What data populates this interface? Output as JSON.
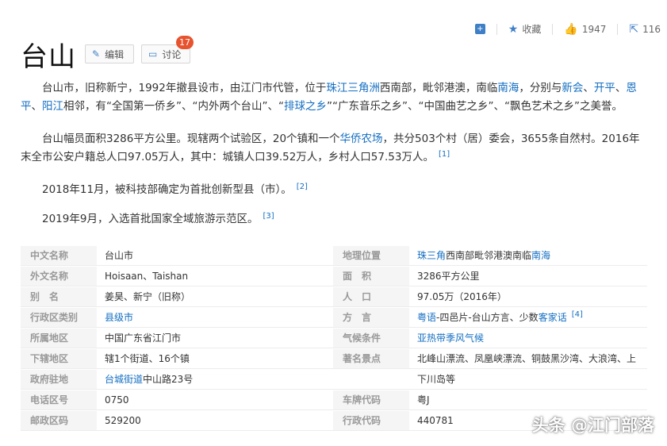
{
  "title": "台山",
  "buttons": {
    "edit": "编辑",
    "discuss": "讨论",
    "discuss_count": "17"
  },
  "toolbar": {
    "collect": "收藏",
    "likes": "1947",
    "shares": "116"
  },
  "para1": {
    "a": "台山市，旧称新宁，1992年撤县设市，由江门市代管，位于",
    "l1": "珠江三角洲",
    "b": "西南部，毗邻港澳，南临",
    "l2": "南海",
    "c": "，分别与",
    "l3": "新会",
    "d": "、",
    "l4": "开平",
    "e": "、",
    "l5": "恩平",
    "f": "、",
    "l6": "阳江",
    "g": "相邻，有“全国第一侨乡”、“内外两个台山”、“",
    "l7": "排球之乡",
    "h": "”“广东音乐之乡”、“中国曲艺之乡”、“飘色艺术之乡”之美誉。"
  },
  "para2": {
    "a": "台山幅员面积3286平方公里。现辖两个试验区，20个镇和一个",
    "l1": "华侨农场",
    "b": "，共分503个村（居）委会，3655条自然村。2016年末全市公安户籍总人口97.05万人，其中：城镇人口39.52万人，乡村人口57.53万人。",
    "ref": "[1]"
  },
  "para3": {
    "text": "2018年11月，被科技部确定为首批创新型县（市）。",
    "ref": "[2]"
  },
  "para4": {
    "text": "2019年9月，入选首批国家全域旅游示范区。",
    "ref": "[3]"
  },
  "info": {
    "rows": [
      {
        "l1": "中文名称",
        "v1": "台山市",
        "l2": "地理位置",
        "v2a": "珠三角",
        "v2b": "西南部毗邻港澳南临",
        "v2c": "南海"
      },
      {
        "l1": "外文名称",
        "v1": "Hoisaan、Taishan",
        "l2": "面　积",
        "v2": "3286平方公里"
      },
      {
        "l1": "别　名",
        "v1": "姜昊、新宁（旧称）",
        "l2": "人　口",
        "v2": "97.05万（2016年）"
      },
      {
        "l1": "行政区类别",
        "v1": "县级市",
        "l2": "方　言",
        "v2a": "粤语",
        "v2b": "-四邑片-台山方言、少数",
        "v2c": "客家话",
        "ref": "[4]"
      },
      {
        "l1": "所属地区",
        "v1": "中国广东省江门市",
        "l2": "气候条件",
        "v2": "亚热带季风气候"
      },
      {
        "l1": "下辖地区",
        "v1": "辖1个街道、16个镇",
        "l2": "著名景点",
        "v2": "北峰山漂流、凤凰峡漂流、铜鼓黑沙湾、大浪湾、上"
      },
      {
        "l1": "政府驻地",
        "v1a": "台城街道",
        "v1b": "中山路23号",
        "l2": "",
        "v2": "下川岛等"
      },
      {
        "l1": "电话区号",
        "v1": "0750",
        "l2": "车牌代码",
        "v2": "粤J"
      },
      {
        "l1": "邮政区码",
        "v1": "529200",
        "l2": "行政代码",
        "v2": "440781"
      }
    ]
  },
  "watermark": "头条 @江门部落"
}
